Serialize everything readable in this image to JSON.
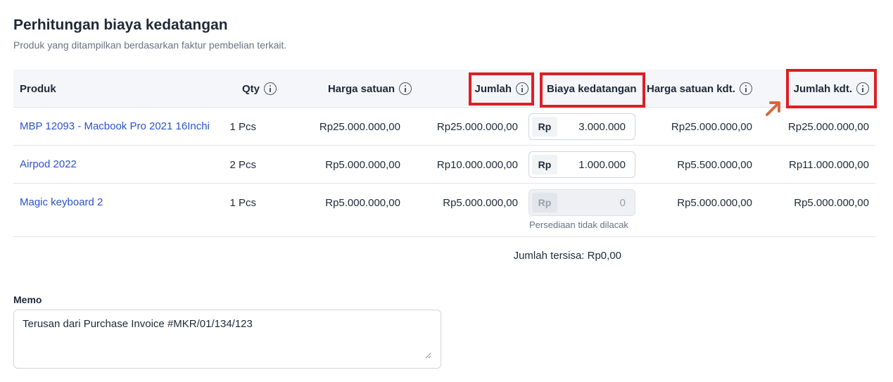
{
  "header": {
    "title": "Perhitungan biaya kedatangan",
    "subtitle": "Produk yang ditampilkan berdasarkan faktur pembelian terkait."
  },
  "table": {
    "columns": {
      "product": "Produk",
      "qty": "Qty",
      "unit_price": "Harga satuan",
      "amount": "Jumlah",
      "landed_cost": "Biaya kedatangan",
      "landed_unit_price": "Harga satuan kdt.",
      "landed_amount": "Jumlah kdt."
    },
    "currency_prefix": "Rp",
    "rows": [
      {
        "product": "MBP 12093 - Macbook Pro 2021 16Inchi",
        "qty": "1 Pcs",
        "unit_price": "Rp25.000.000,00",
        "amount": "Rp25.000.000,00",
        "landed_cost": "3.000.000",
        "landed_unit_price": "Rp25.000.000,00",
        "landed_amount": "Rp25.000.000,00"
      },
      {
        "product": "Airpod 2022",
        "qty": "2 Pcs",
        "unit_price": "Rp5.000.000,00",
        "amount": "Rp10.000.000,00",
        "landed_cost": "1.000.000",
        "landed_unit_price": "Rp5.500.000,00",
        "landed_amount": "Rp11.000.000,00"
      },
      {
        "product": "Magic keyboard 2",
        "qty": "1 Pcs",
        "unit_price": "Rp5.000.000,00",
        "amount": "Rp5.000.000,00",
        "landed_cost": "0",
        "landed_cost_note": "Persediaan tidak dilacak",
        "landed_unit_price": "Rp5.000.000,00",
        "landed_amount": "Rp5.000.000,00"
      }
    ],
    "remaining": "Jumlah tersisa: Rp0,00"
  },
  "memo": {
    "label": "Memo",
    "value": "Terusan dari Purchase Invoice #MKR/01/134/123"
  },
  "annotations": {
    "highlight_color": "#dc1f26",
    "arrow_color": "#d5683f"
  }
}
